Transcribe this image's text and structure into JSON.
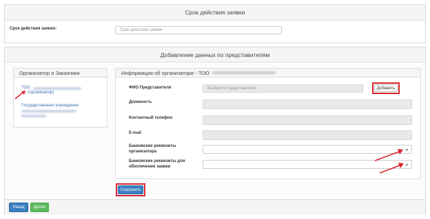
{
  "term_panel": {
    "title": "Срок действия заявки",
    "label": "Срок действия заявки:",
    "placeholder": "Срок действия заявки"
  },
  "rep_panel": {
    "title": "Добавление данных по представителям",
    "org_box": {
      "title": "Организатор и Заказчики",
      "items": [
        {
          "prefix": "ТОО",
          "suffix": "Организатор)"
        },
        {
          "prefix": "Государственное учреждение"
        }
      ]
    },
    "info_box": {
      "title": "Информация об организаторе - ТОО",
      "fields": {
        "fio_label": "ФИО Представителя",
        "fio_placeholder": "Выберите представителя",
        "add_button": "Добавить",
        "position_label": "Должность",
        "phone_label": "Контактный телефон",
        "email_label": "E-mail",
        "bank_org_label_1": "Банковские реквизиты",
        "bank_org_label_2": "организатора",
        "bank_sec_label_1": "Банковские реквизиты для",
        "bank_sec_label_2": "обеспечения заявки"
      }
    },
    "save_button": "Сохранить",
    "back_button": "Назад",
    "next_button": "Далее"
  },
  "colors": {
    "accent": "#3a7fc1",
    "success": "#5cb85c",
    "highlight": "#d9232e"
  }
}
